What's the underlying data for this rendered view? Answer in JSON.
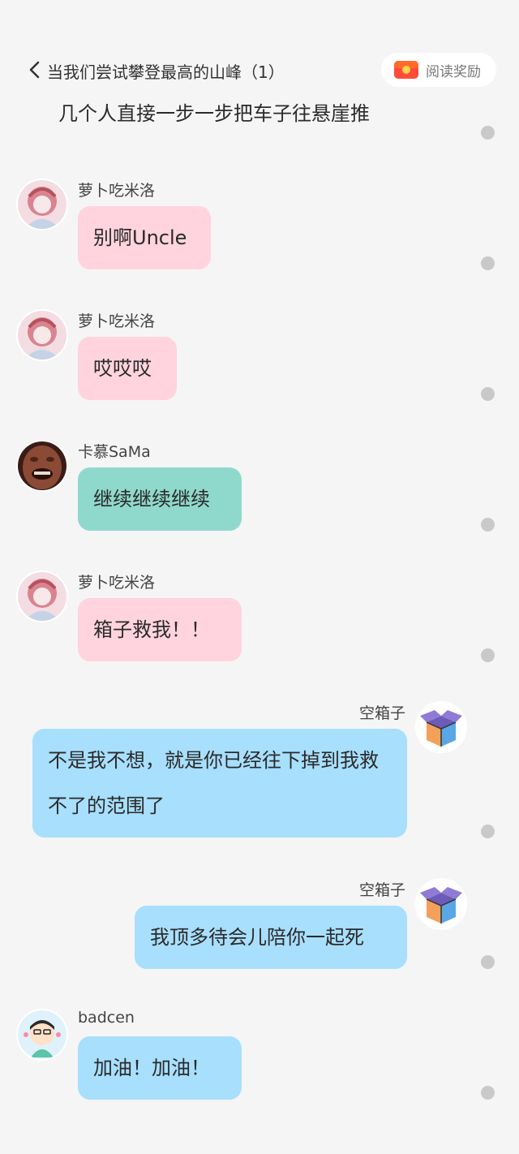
{
  "header": {
    "title": "当我们尝试攀登最高的山峰（1）",
    "reward_label": "阅读奖励"
  },
  "narration": "几个人直接一步一步把车子往悬崖推",
  "messages": [
    {
      "sender": "萝卜吃米洛",
      "text": "别啊Uncle",
      "side": "left",
      "color": "#ffd4df"
    },
    {
      "sender": "萝卜吃米洛",
      "text": "哎哎哎",
      "side": "left",
      "color": "#ffd4df"
    },
    {
      "sender": "卡慕SaMa",
      "text": "继续继续继续",
      "side": "left",
      "color": "#8fd9cc"
    },
    {
      "sender": "萝卜吃米洛",
      "text": "箱子救我！！",
      "side": "left",
      "color": "#ffd4df"
    },
    {
      "sender": "空箱子",
      "text": "不是我不想，就是你已经往下掉到我救不了的范围了",
      "side": "right",
      "color": "#a8dffc"
    },
    {
      "sender": "空箱子",
      "text": "我顶多待会儿陪你一起死",
      "side": "right",
      "color": "#a8dffc"
    },
    {
      "sender": "badcen",
      "text": "加油！加油！",
      "side": "left",
      "color": "#a8dffc"
    }
  ],
  "icons": {
    "back": "chevron-left-icon",
    "reward": "red-envelope-icon",
    "comment_dot": "comment-dot-icon",
    "box_avatar": "open-box-icon"
  }
}
